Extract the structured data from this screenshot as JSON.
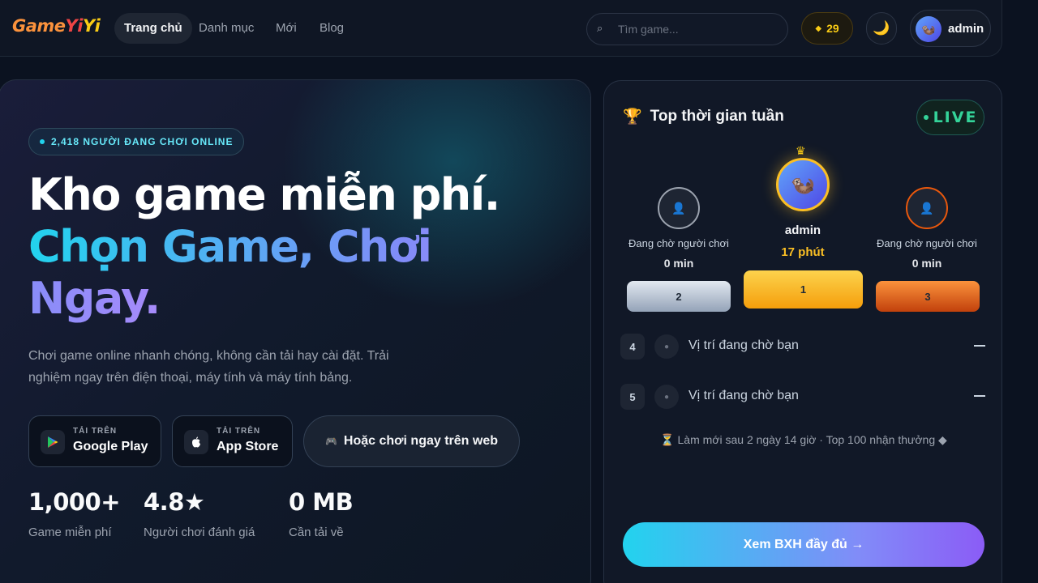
{
  "nav": {
    "logo_parts": [
      "Game",
      "Yi",
      "Yi"
    ],
    "links": [
      "Trang chủ",
      "Danh mục",
      "Mới",
      "Blog"
    ],
    "active_link": "Trang chủ",
    "search_placeholder": "Tìm game...",
    "coins": "29",
    "coin_icon": "diamond-icon",
    "theme_icon": "moon-icon",
    "user_name": "admin"
  },
  "hero": {
    "online_pill": "2,418 NGƯỜI ĐANG CHƠI ONLINE",
    "headline_line1": "Kho game miễn phí.",
    "headline_line2": "Chọn Game, Chơi Ngay.",
    "description": "Chơi game online nhanh chóng, không cần tải hay cài đặt. Trải nghiệm ngay trên điện thoại, máy tính và máy tính bảng.",
    "google_play": {
      "small": "TẢI TRÊN",
      "big": "Google Play"
    },
    "app_store": {
      "small": "TẢI TRÊN",
      "big": "App Store"
    },
    "web_button": "Hoặc chơi ngay trên web",
    "stats": [
      {
        "value": "1,000+",
        "label": "Game miễn phí"
      },
      {
        "value": "4.8★",
        "label": "Người chơi đánh giá"
      },
      {
        "value": "0 MB",
        "label": "Cần tải về"
      }
    ]
  },
  "leaderboard": {
    "title": "Top thời gian tuần",
    "live": "LIVE",
    "podium": [
      {
        "rank": "1",
        "name": "admin",
        "time": "17 phút"
      },
      {
        "rank": "2",
        "name": "Đang chờ người chơi",
        "time": "0 min"
      },
      {
        "rank": "3",
        "name": "Đang chờ người chơi",
        "time": "0 min"
      }
    ],
    "rows": [
      {
        "rank": "4",
        "text": "Vị trí đang chờ bạn"
      },
      {
        "rank": "5",
        "text": "Vị trí đang chờ bạn"
      }
    ],
    "refresh_note": "⏳ Làm mới sau 2 ngày 14 giờ · Top 100 nhận thưởng ◆",
    "full_button": "Xem BXH đầy đủ →"
  },
  "colors": {
    "accent_cyan": "#22d3ee",
    "accent_violet": "#8b5cf6",
    "gold": "#facc15",
    "live_green": "#34d399"
  }
}
